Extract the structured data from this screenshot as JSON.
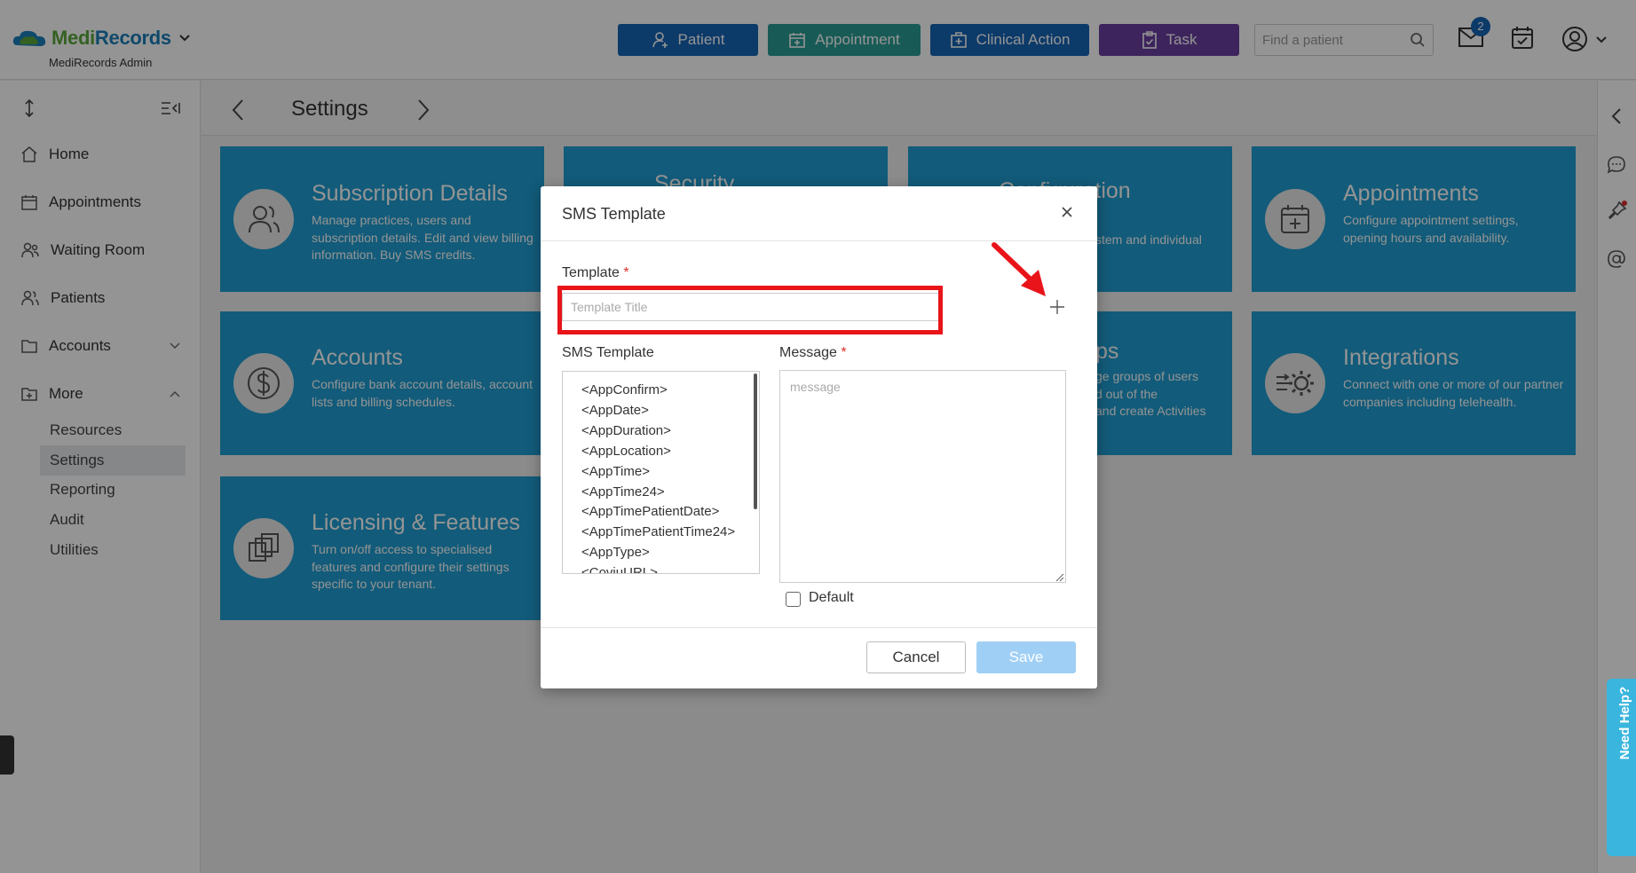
{
  "app": {
    "brand_part1": "Medi",
    "brand_part2": "Records",
    "subtitle": "MediRecords Admin"
  },
  "header": {
    "buttons": [
      {
        "label": "Patient",
        "icon": "user-plus-icon",
        "color": "#1565b5"
      },
      {
        "label": "Appointment",
        "icon": "calendar-plus-icon",
        "color": "#2a9d94"
      },
      {
        "label": "Clinical Action",
        "icon": "medical-bag-icon",
        "color": "#1565b5"
      },
      {
        "label": "Task",
        "icon": "clipboard-check-icon",
        "color": "#6a3ea1"
      }
    ],
    "search_placeholder": "Find a patient",
    "mail_badge": "2"
  },
  "sidebar": {
    "items": [
      {
        "label": "Home",
        "icon": "home-icon"
      },
      {
        "label": "Appointments",
        "icon": "calendar-icon"
      },
      {
        "label": "Waiting Room",
        "icon": "people-icon"
      },
      {
        "label": "Patients",
        "icon": "users-icon"
      },
      {
        "label": "Accounts",
        "icon": "folder-icon"
      },
      {
        "label": "More",
        "icon": "folder-plus-icon"
      }
    ],
    "sub_items": [
      "Resources",
      "Settings",
      "Reporting",
      "Audit",
      "Utilities"
    ],
    "active_sub": "Settings"
  },
  "page": {
    "title": "Settings"
  },
  "cards": [
    {
      "title": "Subscription Details",
      "desc": "Manage practices, users and subscription details. Edit and view billing information. Buy SMS credits."
    },
    {
      "title": "Security",
      "desc": ""
    },
    {
      "title": "Configuration",
      "desc": "stem and individual"
    },
    {
      "title": "Appointments",
      "desc": "Configure appointment settings, opening hours and availability."
    },
    {
      "title": "Accounts",
      "desc": "Configure bank account details, account lists and billing schedules."
    },
    {
      "title": "ps",
      "desc": "ge groups of users\nd out of the\nand create Activities"
    },
    {
      "title": "Integrations",
      "desc": "Connect with one or more of our partner companies including telehealth."
    },
    {
      "title": "Licensing & Features",
      "desc": "Turn on/off access to specialised features and configure their settings specific to your tenant."
    }
  ],
  "modal": {
    "title": "SMS Template",
    "template_label": "Template",
    "template_placeholder": "Template Title",
    "list_label": "SMS Template",
    "message_label": "Message",
    "message_placeholder": "message",
    "variables": [
      "<AppConfirm>",
      "<AppDate>",
      "<AppDuration>",
      "<AppLocation>",
      "<AppTime>",
      "<AppTime24>",
      "<AppTimePatientDate>",
      "<AppTimePatientTime24>",
      "<AppType>",
      "<CoviuURL>"
    ],
    "default_label": "Default",
    "cancel_label": "Cancel",
    "save_label": "Save",
    "required_mark": "*"
  },
  "help": {
    "label": "Need Help?"
  }
}
